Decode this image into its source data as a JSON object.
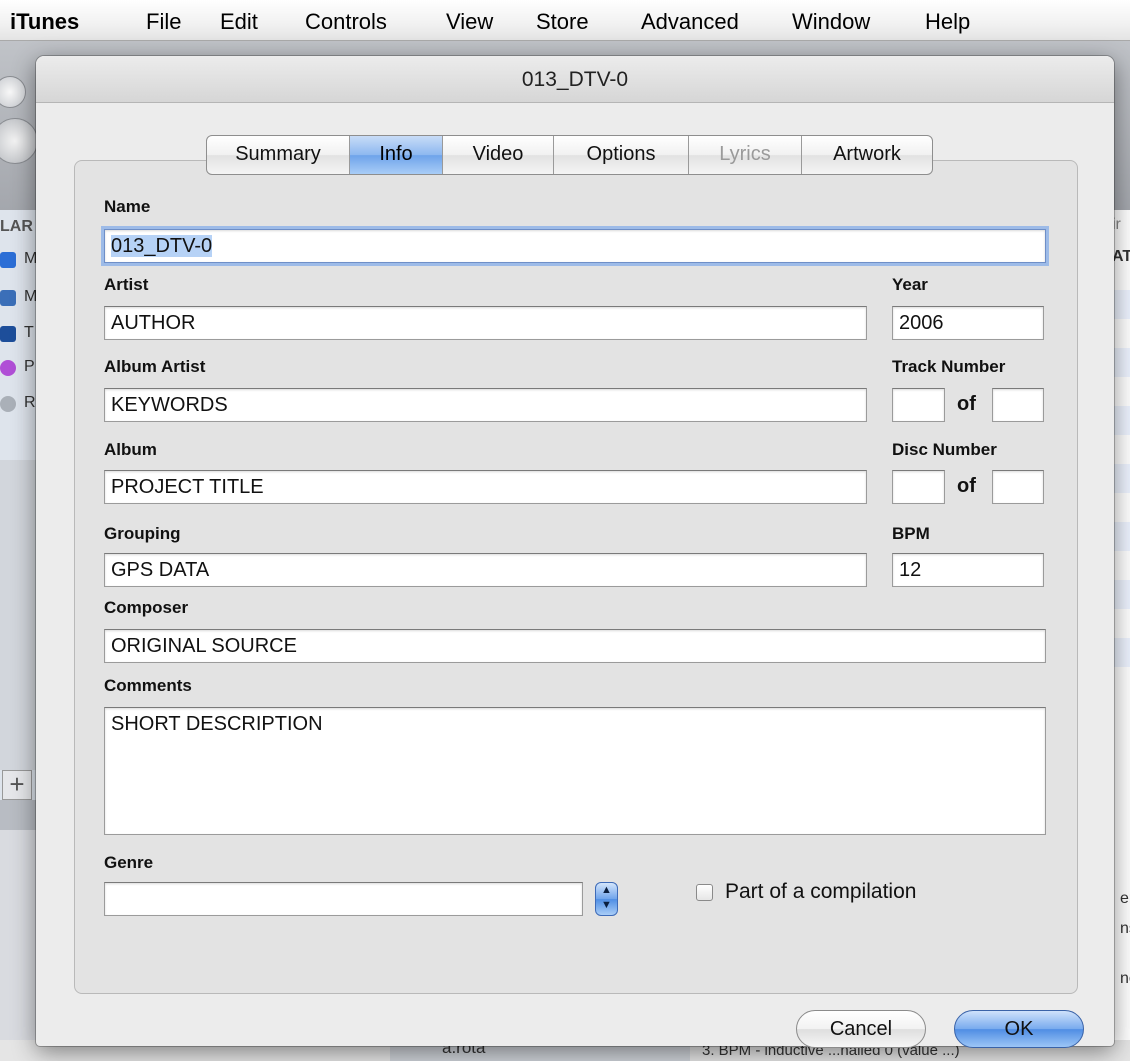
{
  "menubar": {
    "items": [
      "iTunes",
      "File",
      "Edit",
      "Controls",
      "View",
      "Store",
      "Advanced",
      "Window",
      "Help"
    ]
  },
  "dialog": {
    "title": "013_DTV-0",
    "tabs": [
      {
        "label": "Summary",
        "state": "normal"
      },
      {
        "label": "Info",
        "state": "selected"
      },
      {
        "label": "Video",
        "state": "normal"
      },
      {
        "label": "Options",
        "state": "normal"
      },
      {
        "label": "Lyrics",
        "state": "disabled"
      },
      {
        "label": "Artwork",
        "state": "normal"
      }
    ],
    "fields": {
      "name": {
        "label": "Name",
        "value": "013_DTV-0"
      },
      "artist": {
        "label": "Artist",
        "value": "AUTHOR"
      },
      "year": {
        "label": "Year",
        "value": "2006"
      },
      "album_artist": {
        "label": "Album Artist",
        "value": "KEYWORDS"
      },
      "track_number": {
        "label": "Track Number",
        "value": "",
        "of_label": "of",
        "total": ""
      },
      "album": {
        "label": "Album",
        "value": "PROJECT TITLE"
      },
      "disc_number": {
        "label": "Disc Number",
        "value": "",
        "of_label": "of",
        "total": ""
      },
      "grouping": {
        "label": "Grouping",
        "value": "GPS DATA"
      },
      "bpm": {
        "label": "BPM",
        "value": "12"
      },
      "composer": {
        "label": "Composer",
        "value": "ORIGINAL SOURCE"
      },
      "comments": {
        "label": "Comments",
        "value": "SHORT DESCRIPTION"
      },
      "genre": {
        "label": "Genre",
        "value": ""
      },
      "compilation": {
        "label": "Part of a compilation",
        "checked": false
      }
    },
    "buttons": {
      "cancel": "Cancel",
      "ok": "OK"
    }
  },
  "background": {
    "left_fragments": [
      "LAR",
      "M",
      "M",
      "T",
      "P",
      "R"
    ],
    "right_fragments": [
      "ir",
      "AT",
      "er",
      "ns",
      "ne"
    ],
    "bottom_fragment": "a.rota",
    "bottom_right_fragment": "3. BPM - inductive ...nailed 0 (value ...)"
  },
  "colors": {
    "selection": "#b6d2f6",
    "focus_ring": "#9dbbe8",
    "aqua_blue": "#4f8de4"
  }
}
